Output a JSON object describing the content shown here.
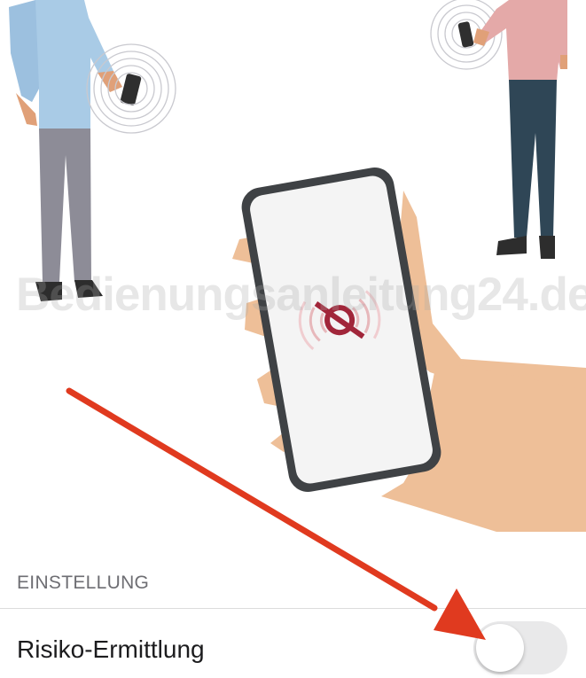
{
  "watermark": "Bedienungsanleitung24.de",
  "settings": {
    "section_header": "EINSTELLUNG",
    "risk_detection": {
      "label": "Risiko-Ermittlung",
      "toggle_on": false
    }
  },
  "icons": [
    "phone-icon",
    "exposure-notification-disabled-icon"
  ],
  "colors": {
    "arrow": "#e03a1f",
    "toggle_off": "#e9e9ea",
    "icon_red": "#a1263a"
  }
}
